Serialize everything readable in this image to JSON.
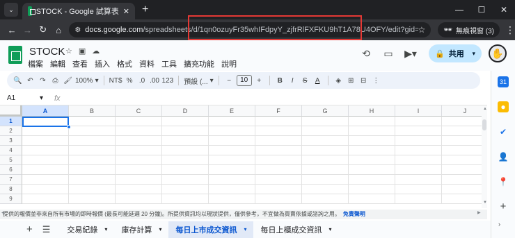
{
  "browser": {
    "tab_title": "STOCK - Google 試算表",
    "tab_close": "✕",
    "new_tab": "+",
    "tab_list": "⌄",
    "window": {
      "minimize": "—",
      "maximize": "☐",
      "close": "✕"
    },
    "nav": {
      "back": "←",
      "forward": "→",
      "reload": "↻",
      "home": "⌂"
    },
    "url_host": "docs.google.com",
    "url_path": "/spreadsheets/d/1qn0ozuyFr35whIFdpyY_zjfrRlFXFKU9hT1A78U4OFY/edit?gid=13878...",
    "incognito_label": "無痕視窗 (3)",
    "menu": "⋮"
  },
  "sheets": {
    "doc_title": "STOCK",
    "menus": [
      "檔案",
      "編輯",
      "查看",
      "插入",
      "格式",
      "資料",
      "工具",
      "擴充功能",
      "說明"
    ],
    "share_label": "共用",
    "share_caret": "▾"
  },
  "toolbar": {
    "zoom": "100%",
    "zoom_caret": "▾",
    "currency": "NT$",
    "percent": "%",
    "dec_decrease": ".0",
    "dec_increase": ".00",
    "number_format": "123",
    "font": "預設 (...",
    "font_caret": "▾",
    "font_minus": "−",
    "font_size": "10",
    "font_plus": "+",
    "bold": "B",
    "italic": "I",
    "strike": "S",
    "text_color": "A",
    "more": "⋮"
  },
  "formula_bar": {
    "cell_ref": "A1",
    "cell_ref_caret": "▾",
    "fx": "fx"
  },
  "grid": {
    "columns": [
      "A",
      "B",
      "C",
      "D",
      "E",
      "F",
      "G",
      "H",
      "I",
      "J"
    ],
    "rows": [
      "1",
      "2",
      "3",
      "4",
      "5",
      "6",
      "7",
      "8",
      "9"
    ],
    "selected_cell": "A1"
  },
  "disclaimer": {
    "text": "提供的報價並非來自所有市場的即時報價 (最長可能延遲 20 分鐘)。所提供資訊均以現狀提供，僅供參考，不宜做為買賣依據或諮詢之用。",
    "link": "免責聲明"
  },
  "sheet_tabs": {
    "add": "+",
    "all": "☰",
    "tabs": [
      {
        "label": "交易紀錄",
        "active": false
      },
      {
        "label": "庫存計算",
        "active": false
      },
      {
        "label": "每日上市成交資訊",
        "active": true
      },
      {
        "label": "每日上櫃成交資訊",
        "active": false
      }
    ],
    "caret": "▾",
    "collapse": "›"
  },
  "colors": {
    "chrome_dark": "#202124",
    "chrome_toolbar": "#35363a",
    "sheets_green": "#0f9d58",
    "share_bg": "#c2e7ff",
    "selection_blue": "#1a73e8",
    "highlight_box": "#e53935"
  }
}
